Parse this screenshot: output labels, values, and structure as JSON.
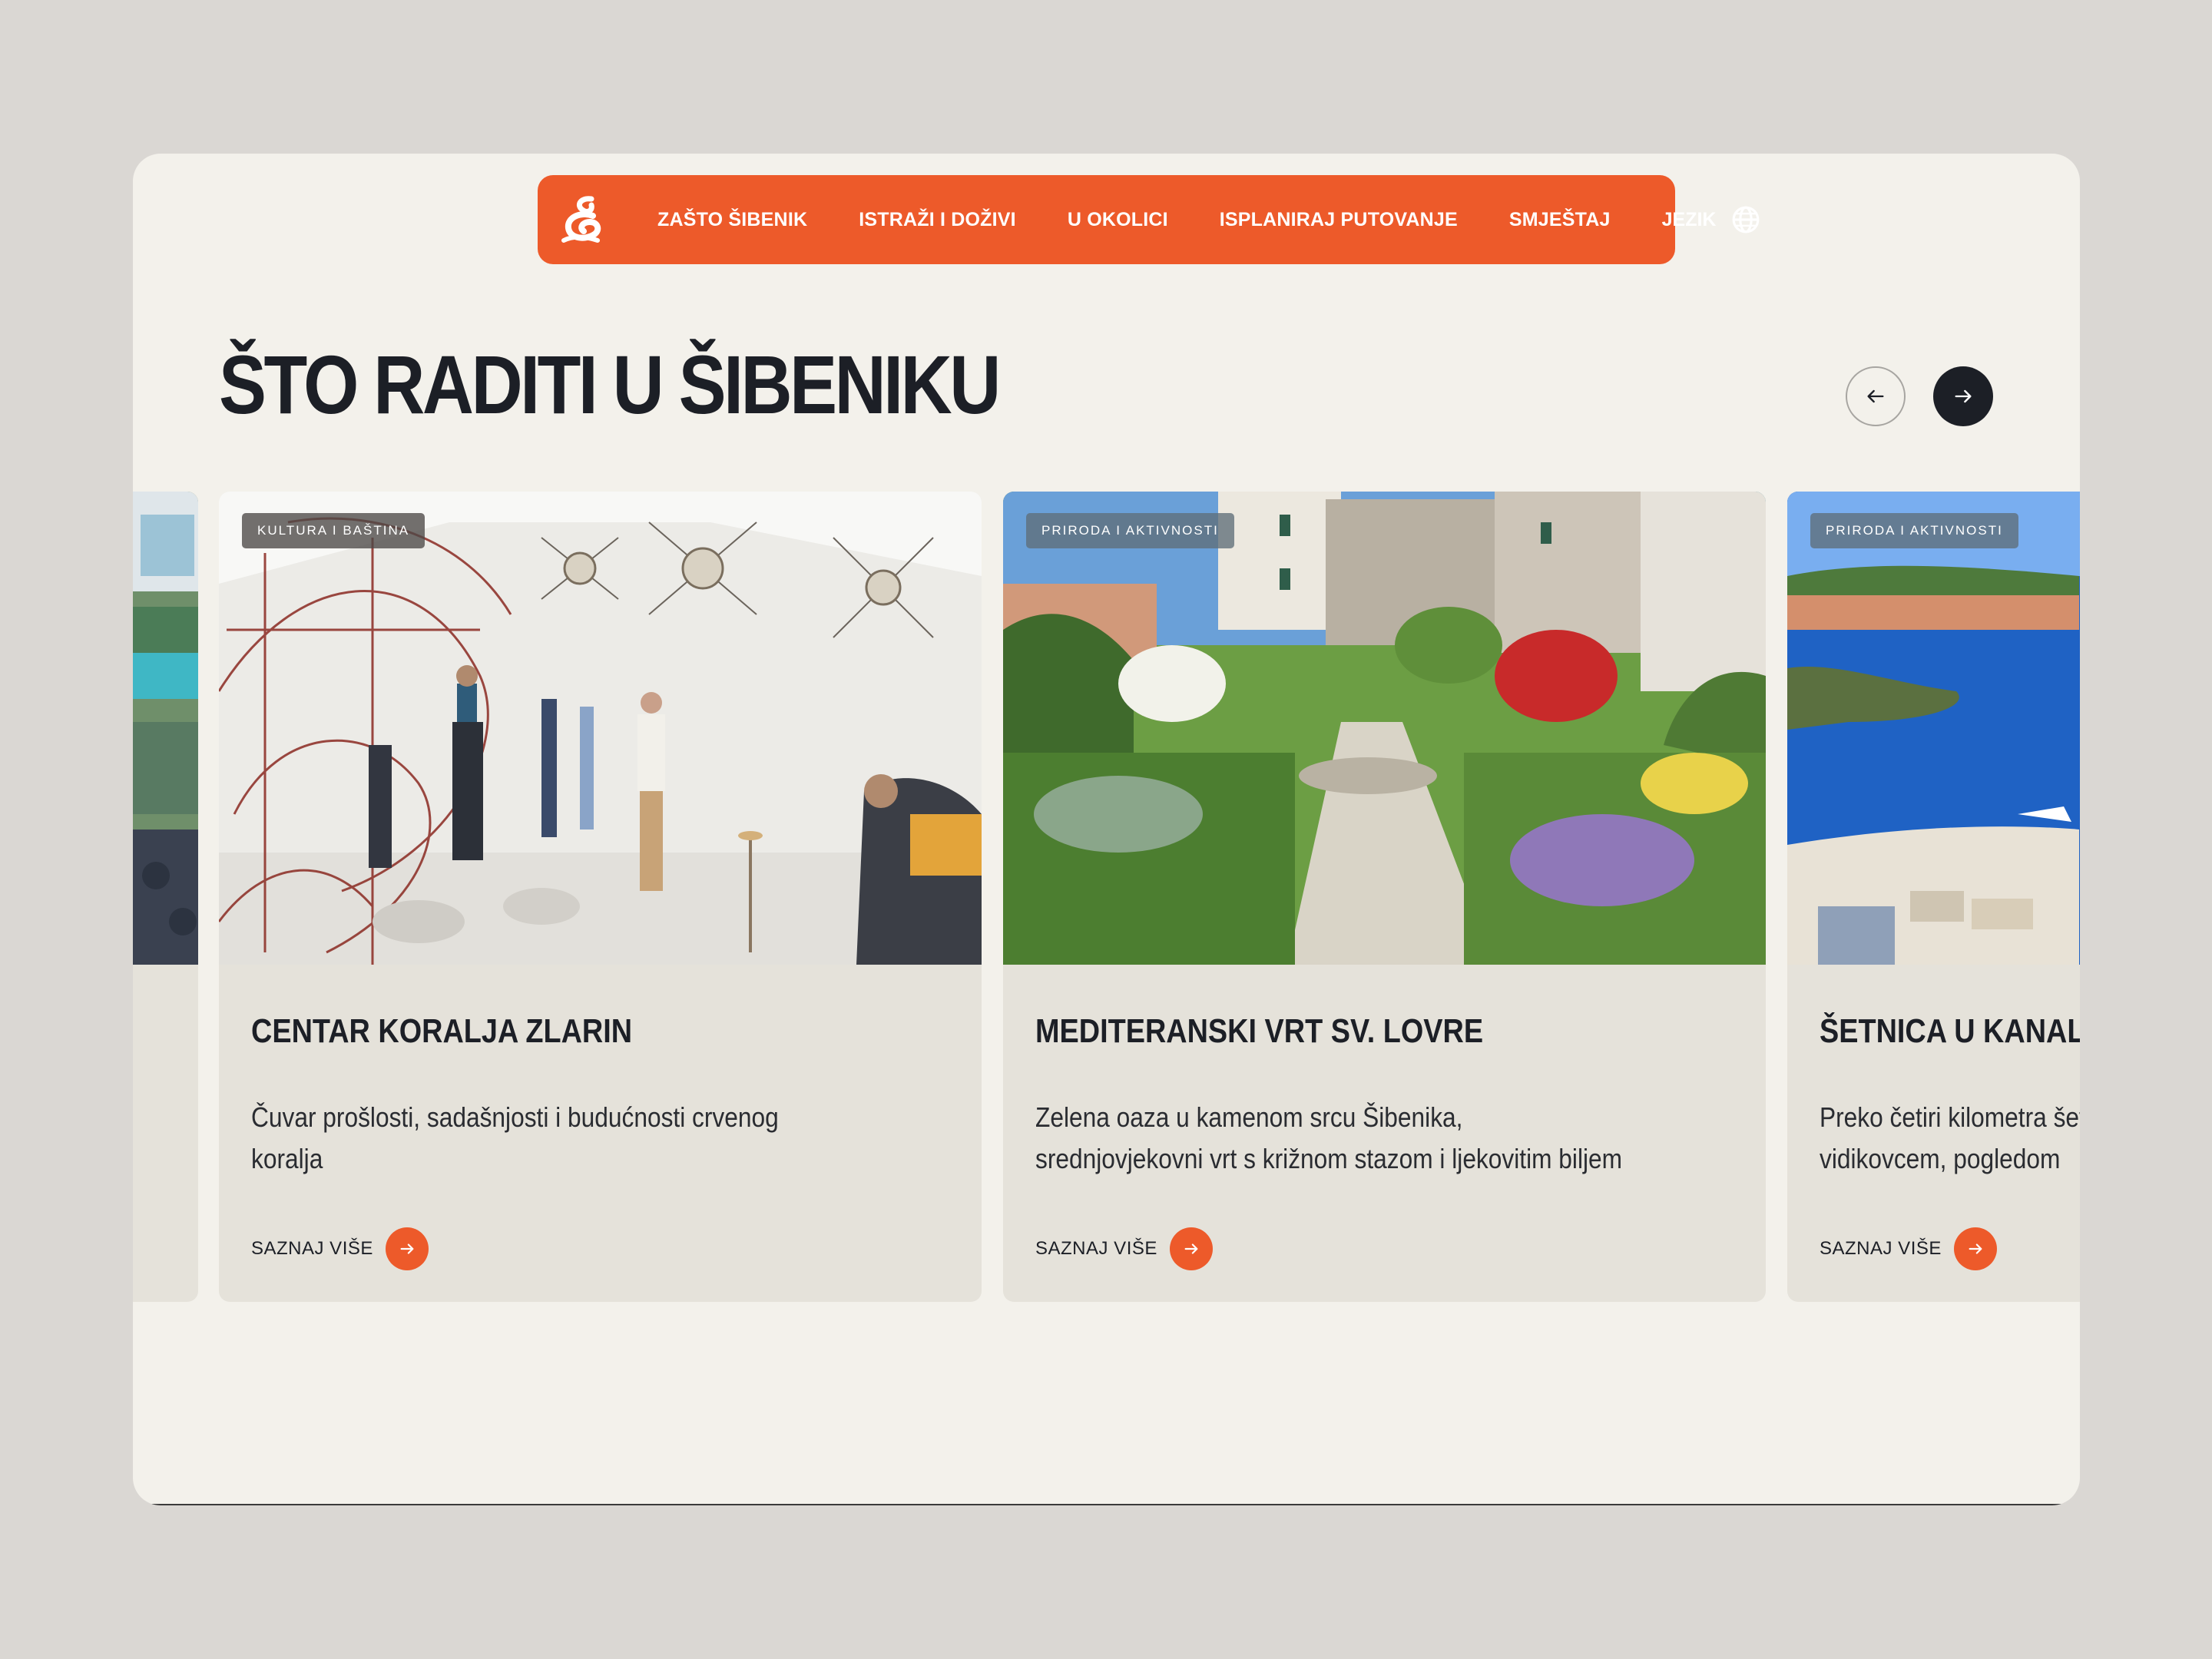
{
  "nav": {
    "logo_icon": "sibenik-logo-icon",
    "items": [
      {
        "label": "ZAŠTO ŠIBENIK"
      },
      {
        "label": "ISTRAŽI I DOŽIVI"
      },
      {
        "label": "U OKOLICI"
      },
      {
        "label": "ISPLANIRAJ PUTOVANJE"
      },
      {
        "label": "SMJEŠTAJ"
      }
    ],
    "language_label": "JEZIK",
    "language_icon": "globe-icon"
  },
  "section": {
    "title": "ŠTO RADITI U ŠIBENIKU",
    "prev_icon": "arrow-left-icon",
    "next_icon": "arrow-right-icon"
  },
  "cards": [
    {
      "tag": "KULTURA I BAŠTINA",
      "title": "CENTAR KORALJA ZLARIN",
      "description": "Čuvar prošlosti, sadašnjosti i budućnosti crvenog koralja",
      "more_label": "SAZNAJ VIŠE"
    },
    {
      "tag": "PRIRODA I AKTIVNOSTI",
      "title": "MEDITERANSKI VRT SV. LOVRE",
      "description": "Zelena oaza u kamenom srcu Šibenika, srednjovjekovni vrt s križnom stazom i ljekovitim biljem",
      "more_label": "SAZNAJ VIŠE"
    },
    {
      "tag": "PRIRODA I AKTIVNOSTI",
      "title": "ŠETNICA U KANALU SV. ANTE",
      "description": "Preko četiri kilometra šetnice uz kanal Sv. Ante, s vidikovcem, pogledom",
      "more_label": "SAZNAJ VIŠE"
    }
  ],
  "colors": {
    "accent": "#ed5a2a",
    "dark": "#1c1f26",
    "page_bg": "#dad7d3",
    "frame_bg": "#f3f1eb",
    "card_bg": "#e5e2da"
  }
}
